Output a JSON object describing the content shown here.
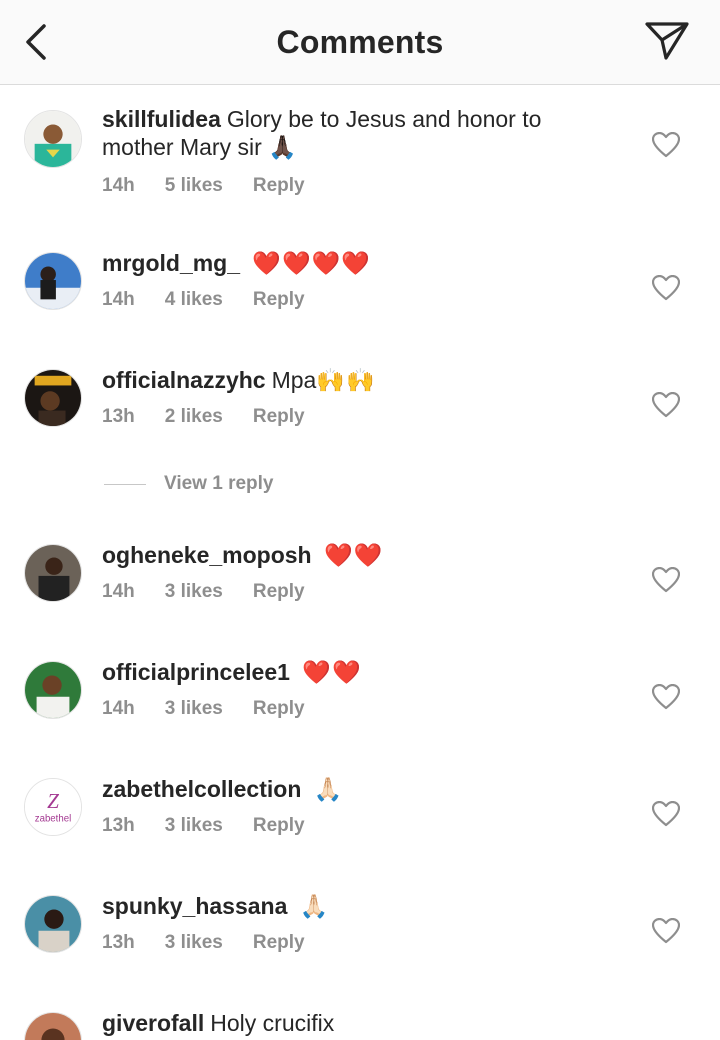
{
  "header": {
    "title": "Comments"
  },
  "comments": [
    {
      "username": "skillfulidea",
      "text": "Glory be to Jesus and honor to mother Mary sir",
      "emoji": "🙏🏿",
      "time": "14h",
      "likes": "5 likes",
      "reply": "Reply"
    },
    {
      "username": "mrgold_mg_",
      "text": "",
      "emoji": "❤️❤️❤️❤️",
      "time": "14h",
      "likes": "4 likes",
      "reply": "Reply"
    },
    {
      "username": "officialnazzyhc",
      "text": "Mpa",
      "emoji": "🙌🙌",
      "time": "13h",
      "likes": "2 likes",
      "reply": "Reply"
    },
    {
      "username": "ogheneke_moposh",
      "text": "",
      "emoji": "❤️❤️",
      "time": "14h",
      "likes": "3 likes",
      "reply": "Reply"
    },
    {
      "username": "officialprincelee1",
      "text": "",
      "emoji": "❤️❤️",
      "time": "14h",
      "likes": "3 likes",
      "reply": "Reply"
    },
    {
      "username": "zabethelcollection",
      "text": "",
      "emoji": "🙏🏻",
      "time": "13h",
      "likes": "3 likes",
      "reply": "Reply",
      "avatar_text": "zabethel"
    },
    {
      "username": "spunky_hassana",
      "text": "",
      "emoji": "🙏🏻",
      "time": "13h",
      "likes": "3 likes",
      "reply": "Reply"
    },
    {
      "username": "giverofall",
      "text": "Holy crucifix"
    }
  ],
  "view_reply": "View 1 reply",
  "colors": {
    "text": "#262626",
    "secondary": "#8e8e8e",
    "header_bg": "#fafafa",
    "border": "#dbdbdb"
  }
}
